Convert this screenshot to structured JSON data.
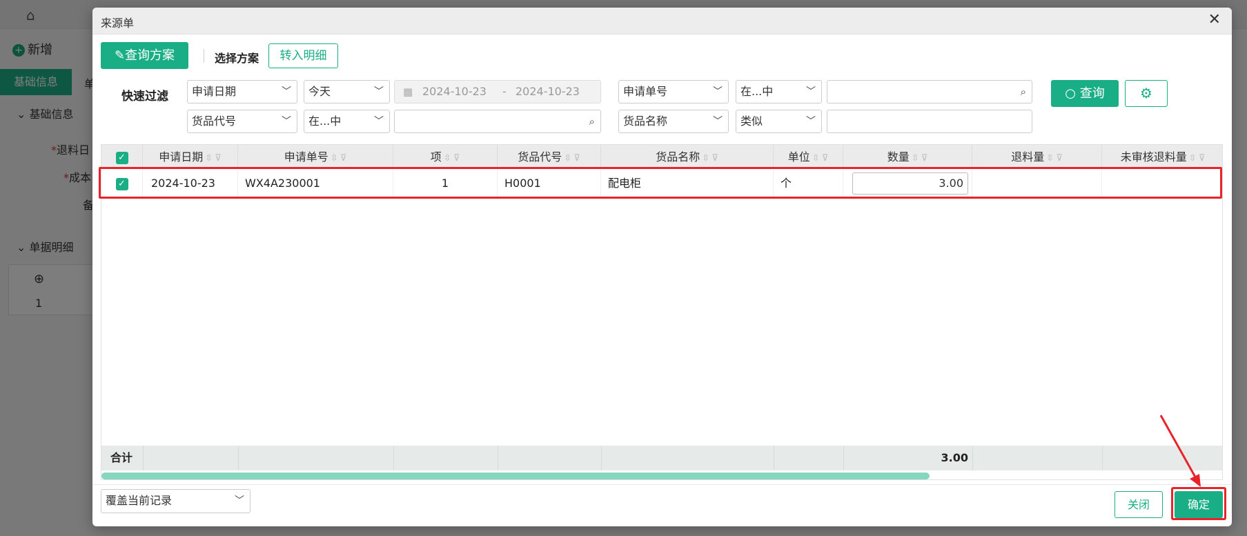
{
  "background": {
    "toolbar_new_label": "新增",
    "tab_basic": "基础信息",
    "tab_partial": "单",
    "section_basic": "基础信息",
    "field_return_date": "退料日",
    "field_cost": "成本",
    "field_note": "备",
    "section_detail": "单据明细",
    "grid_row_no": "1"
  },
  "dialog": {
    "title": "来源单",
    "toolbar": {
      "query_plan_label": "查询方案",
      "choose_plan_label": "选择方案",
      "transfer_detail_label": "转入明细"
    },
    "filter": {
      "quick_filter_label": "快速过滤",
      "row1": {
        "field1": "申请日期",
        "op1": "今天",
        "date_from": "2024-10-23",
        "date_sep": "-",
        "date_to": "2024-10-23",
        "field2": "申请单号",
        "op2": "在...中",
        "value2": ""
      },
      "row2": {
        "field1": "货品代号",
        "op1": "在...中",
        "value1": "",
        "field2": "货品名称",
        "op2": "类似",
        "value2": ""
      },
      "query_button": "查询"
    },
    "table": {
      "columns": [
        "申请日期",
        "申请单号",
        "项",
        "货品代号",
        "货品名称",
        "单位",
        "数量",
        "退料量",
        "未审核退料量"
      ],
      "rows": [
        {
          "checked": true,
          "apply_date": "2024-10-23",
          "apply_no": "WX4A230001",
          "item": "1",
          "goods_code": "H0001",
          "goods_name": "配电柜",
          "unit": "个",
          "qty": "3.00",
          "return_qty": "",
          "unaudited_return_qty": ""
        }
      ],
      "footer": {
        "label": "合计",
        "qty_sum": "3.00"
      }
    },
    "footer": {
      "mode_select": "覆盖当前记录",
      "close_button": "关闭",
      "ok_button": "确定"
    }
  },
  "colors": {
    "accent": "#1aae86",
    "highlight": "#e8232a"
  }
}
